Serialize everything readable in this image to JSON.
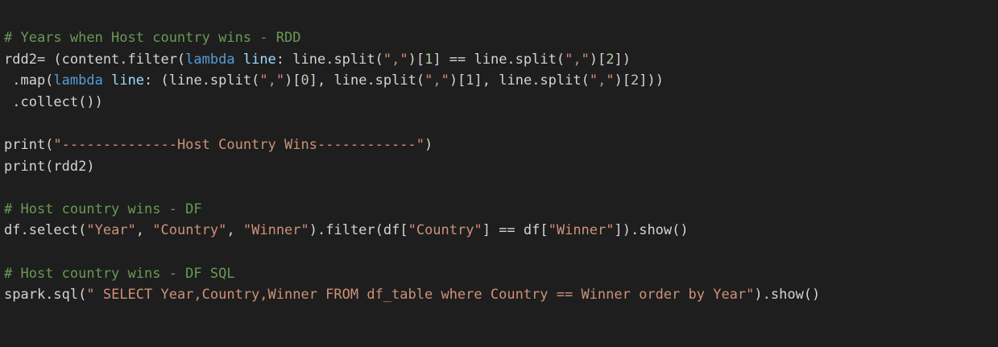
{
  "colors": {
    "background": "#1e1e1e",
    "plain": "#d4d4d4",
    "comment": "#6a9955",
    "string": "#ce9178",
    "keyword": "#569cd6",
    "param": "#9cdcfe",
    "number": "#b5cea8"
  },
  "code_lines": [
    [
      {
        "t": "comment",
        "v": "# Years when Host country wins - RDD"
      }
    ],
    [
      {
        "t": "plain",
        "v": "rdd2= (content.filter("
      },
      {
        "t": "keyword",
        "v": "lambda"
      },
      {
        "t": "plain",
        "v": " "
      },
      {
        "t": "param",
        "v": "line"
      },
      {
        "t": "plain",
        "v": ": line.split("
      },
      {
        "t": "string",
        "v": "\",\""
      },
      {
        "t": "plain",
        "v": ")["
      },
      {
        "t": "number",
        "v": "1"
      },
      {
        "t": "plain",
        "v": "] == line.split("
      },
      {
        "t": "string",
        "v": "\",\""
      },
      {
        "t": "plain",
        "v": ")["
      },
      {
        "t": "number",
        "v": "2"
      },
      {
        "t": "plain",
        "v": "])"
      }
    ],
    [
      {
        "t": "plain",
        "v": " .map("
      },
      {
        "t": "keyword",
        "v": "lambda"
      },
      {
        "t": "plain",
        "v": " "
      },
      {
        "t": "param",
        "v": "line"
      },
      {
        "t": "plain",
        "v": ": (line.split("
      },
      {
        "t": "string",
        "v": "\",\""
      },
      {
        "t": "plain",
        "v": ")["
      },
      {
        "t": "number",
        "v": "0"
      },
      {
        "t": "plain",
        "v": "], line.split("
      },
      {
        "t": "string",
        "v": "\",\""
      },
      {
        "t": "plain",
        "v": ")["
      },
      {
        "t": "number",
        "v": "1"
      },
      {
        "t": "plain",
        "v": "], line.split("
      },
      {
        "t": "string",
        "v": "\",\""
      },
      {
        "t": "plain",
        "v": ")["
      },
      {
        "t": "number",
        "v": "2"
      },
      {
        "t": "plain",
        "v": "]))"
      }
    ],
    [
      {
        "t": "plain",
        "v": " .collect())"
      }
    ],
    [],
    [
      {
        "t": "plain",
        "v": "print("
      },
      {
        "t": "string",
        "v": "\"--------------Host Country Wins------------\""
      },
      {
        "t": "plain",
        "v": ")"
      }
    ],
    [
      {
        "t": "plain",
        "v": "print(rdd2)"
      }
    ],
    [],
    [
      {
        "t": "comment",
        "v": "# Host country wins - DF"
      }
    ],
    [
      {
        "t": "plain",
        "v": "df.select("
      },
      {
        "t": "string",
        "v": "\"Year\""
      },
      {
        "t": "plain",
        "v": ", "
      },
      {
        "t": "string",
        "v": "\"Country\""
      },
      {
        "t": "plain",
        "v": ", "
      },
      {
        "t": "string",
        "v": "\"Winner\""
      },
      {
        "t": "plain",
        "v": ").filter(df["
      },
      {
        "t": "string",
        "v": "\"Country\""
      },
      {
        "t": "plain",
        "v": "] == df["
      },
      {
        "t": "string",
        "v": "\"Winner\""
      },
      {
        "t": "plain",
        "v": "]).show()"
      }
    ],
    [],
    [
      {
        "t": "comment",
        "v": "# Host country wins - DF SQL"
      }
    ],
    [
      {
        "t": "plain",
        "v": "spark.sql("
      },
      {
        "t": "string",
        "v": "\" SELECT Year,Country,Winner FROM df_table where Country == Winner order by Year\""
      },
      {
        "t": "plain",
        "v": ").show()"
      }
    ]
  ]
}
